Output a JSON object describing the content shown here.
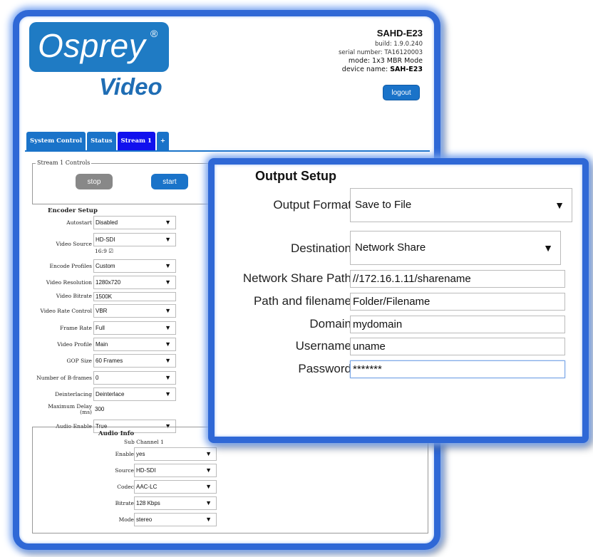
{
  "brand": {
    "logo_text": "Osprey",
    "logo_reg": "®",
    "logo_sub": "Video"
  },
  "device": {
    "title": "SAHD-E23",
    "build": "build: 1.9.0.240",
    "serial": "serial number: TA16120003",
    "mode": "mode: 1x3 MBR Mode",
    "name_label": "device name: ",
    "name_value": "SAH-E23",
    "logout_label": "logout"
  },
  "tabs": [
    {
      "label": "System Control"
    },
    {
      "label": "Status"
    },
    {
      "label": "Stream 1"
    },
    {
      "label": "+"
    }
  ],
  "controls": {
    "legend": "Stream 1 Controls",
    "stop_label": "stop",
    "start_label": "start"
  },
  "encoder": {
    "title": "Encoder Setup",
    "autostart": {
      "label": "Autostart",
      "value": "Disabled"
    },
    "video_source": {
      "label": "Video Source",
      "value": "HD-SDI",
      "aspect": "16:9 ☑"
    },
    "encode_profiles": {
      "label": "Encode Profiles",
      "value": "Custom"
    },
    "video_resolution": {
      "label": "Video Resolution",
      "value": "1280x720"
    },
    "video_bitrate": {
      "label": "Video Bitrate",
      "value": "1500K"
    },
    "video_rate_control": {
      "label": "Video Rate Control",
      "value": "VBR"
    },
    "frame_rate": {
      "label": "Frame Rate",
      "value": "Full"
    },
    "video_profile": {
      "label": "Video Profile",
      "value": "Main"
    },
    "gop_size": {
      "label": "GOP Size",
      "value": "60 Frames"
    },
    "b_frames": {
      "label": "Number of B-frames",
      "value": "0"
    },
    "deinterlacing": {
      "label": "Deinterlacing",
      "value": "Deinterlace"
    },
    "max_delay": {
      "label_1": "Maximum Delay",
      "label_2": "(ms)",
      "value": "300"
    },
    "audio_enable": {
      "label": "Audio Enable",
      "value": "True"
    }
  },
  "audio": {
    "title": "Audio Info",
    "sub_channel": "Sub Channel 1",
    "enable": {
      "label": "Enable",
      "value": "yes"
    },
    "source": {
      "label": "Source",
      "value": "HD-SDI"
    },
    "codec": {
      "label": "Codec",
      "value": "AAC-LC"
    },
    "bitrate": {
      "label": "Bitrate",
      "value": "128 Kbps"
    },
    "mode": {
      "label": "Mode",
      "value": "stereo"
    }
  },
  "output": {
    "title": "Output Setup",
    "format": {
      "label": "Output Format",
      "value": "Save to File"
    },
    "destination": {
      "label": "Destination",
      "value": "Network Share"
    },
    "share_path": {
      "label": "Network Share Path",
      "value": "//172.16.1.11/sharename"
    },
    "filename": {
      "label": "Path and filename",
      "value": "Folder/Filename"
    },
    "domain": {
      "label": "Domain",
      "value": "mydomain"
    },
    "username": {
      "label": "Username",
      "value": "uname"
    },
    "password": {
      "label": "Password",
      "value": "*******"
    }
  },
  "icons": {
    "dropdown_arrow": "▼"
  },
  "colors": {
    "accent": "#1a73c9",
    "active_tab": "#1111ee",
    "frame": "#2f68d6"
  }
}
